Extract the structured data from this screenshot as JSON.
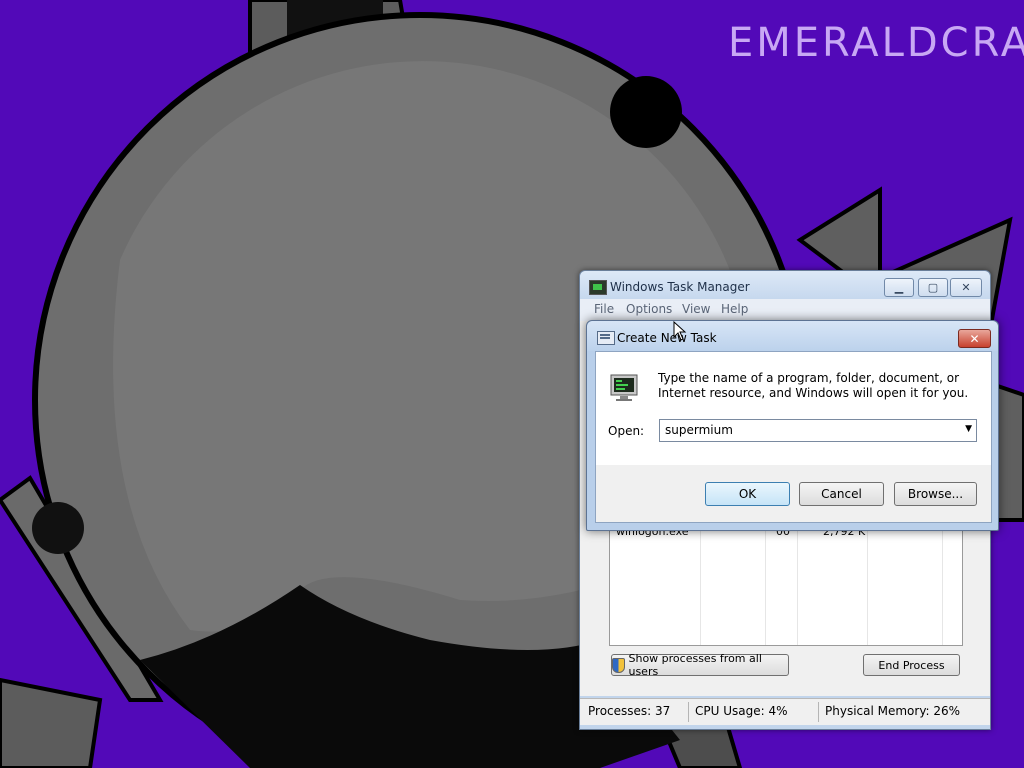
{
  "desktop": {
    "background_color": "#5209b8",
    "brand_text": "EMERALDCRAFT"
  },
  "task_manager": {
    "title": "Windows Task Manager",
    "menu": [
      "File",
      "Options",
      "View",
      "Help"
    ],
    "visible_process": {
      "name": "winlogon.exe",
      "session": "00",
      "memory": "2,792 K"
    },
    "show_all_label": "Show processes from all users",
    "end_process_label": "End Process",
    "status": {
      "processes": "Processes: 37",
      "cpu": "CPU Usage: 4%",
      "memory": "Physical Memory: 26%"
    }
  },
  "dialog": {
    "title": "Create New Task",
    "message": "Type the name of a program, folder, document, or Internet resource, and Windows will open it for you.",
    "open_label": "Open:",
    "open_value": "supermium",
    "buttons": {
      "ok": "OK",
      "cancel": "Cancel",
      "browse": "Browse..."
    }
  },
  "icons": {
    "dialog_close": "close-icon",
    "combo_arrow": "chevron-down-icon",
    "run": "run-program-icon",
    "shield": "uac-shield-icon"
  }
}
